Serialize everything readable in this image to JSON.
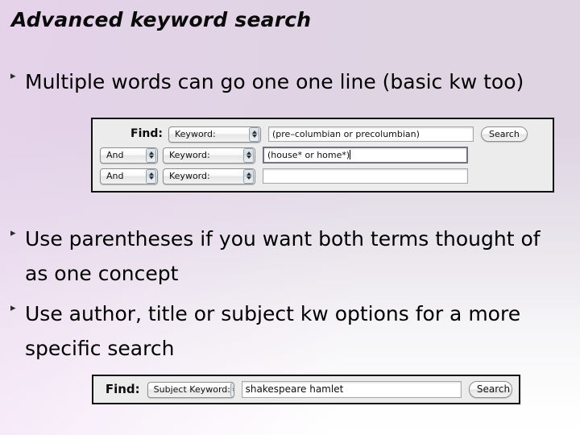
{
  "slide": {
    "title": "Advanced keyword search",
    "background_top_color": "#ded4e2",
    "background_bottom_color": "#ffffff",
    "bullet_glyph": "▸",
    "bullets": [
      {
        "text": "Multiple words can go one one line (basic kw too)"
      },
      {
        "text": "Use parentheses if you want both terms thought of as one concept"
      },
      {
        "text": "Use author, title or subject kw options for a more specific search"
      }
    ]
  },
  "advanced_search_widget": {
    "find_label": "Find:",
    "search_button_label": "Search",
    "rows": [
      {
        "boolean": null,
        "field_label": "Keyword:",
        "value": "(pre–columbian or precolumbian)",
        "focused": false
      },
      {
        "boolean": "And",
        "field_label": "Keyword:",
        "value": "(house* or home*)",
        "focused": true
      },
      {
        "boolean": "And",
        "field_label": "Keyword:",
        "value": "",
        "focused": false
      }
    ]
  },
  "simple_search_widget": {
    "find_label": "Find:",
    "scope_label": "Subject Keyword:",
    "query_value": "shakespeare hamlet",
    "search_button_label": "Search"
  }
}
